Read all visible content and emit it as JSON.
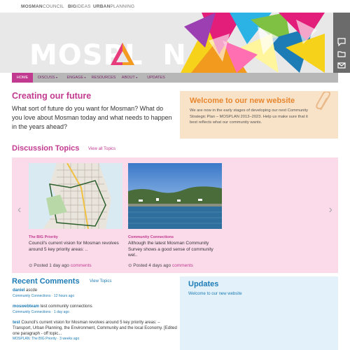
{
  "top_links": [
    {
      "bold": "MOSMAN",
      "rest": "COUNCIL"
    },
    {
      "bold": "BIG",
      "rest": "IDEAS"
    },
    {
      "bold": "URBAN",
      "rest": "PLANNING"
    }
  ],
  "logo": {
    "text": "MOSPL",
    "text_end": "N"
  },
  "side_icons": [
    "speech-bubble-icon",
    "folder-icon",
    "mail-icon"
  ],
  "nav": [
    {
      "label": "HOME",
      "active": true
    },
    {
      "label": "DISCUSS",
      "caret": true
    },
    {
      "label": "ENGAGE",
      "caret": true
    },
    {
      "label": "RESOURCES"
    },
    {
      "label": "ABOUT",
      "caret": true
    },
    {
      "label": "UPDATES"
    }
  ],
  "intro": {
    "title": "Creating our future",
    "body": "What sort of future do you want for Mosman? What do you love about Mosman today and what needs to happen in the years ahead?"
  },
  "welcome": {
    "title": "Welcome to our new website",
    "body": "We are now in the early stages of developing our next Community Strategic Plan – MOSPLAN 2013–2023. Help us make sure that it best reflects what our community wants."
  },
  "discussion": {
    "title": "Discussion Topics",
    "view_all": "View all Topics",
    "cards": [
      {
        "category": "The BIG Priority",
        "excerpt": "Council's current vision for Mosman revolves around 5 key priority areas: ..",
        "posted": "Posted 1 day ago",
        "comments": "comments"
      },
      {
        "category": "Community Connections",
        "excerpt": "Although the latest Mosman Community Survey shows a good sense of community wel..",
        "posted": "Posted 4 days ago",
        "comments": "comments"
      }
    ]
  },
  "recent_comments": {
    "title": "Recent Comments",
    "view_topics": "View Topics",
    "items": [
      {
        "author": "daniel",
        "text": "ascde",
        "meta": "Community Connections · 12 hours ago"
      },
      {
        "author": "moswebteam",
        "text": "test community connections",
        "meta": "Community Connections · 1 day ago"
      },
      {
        "author": "test",
        "text": "Council's current vision for Mosman revolves around 5 key priority areas: – Transport, Urban Planning, the Environment, Community and the local Economy. [Edited one paragraph - off topic...",
        "meta": "MOSPLAN: The BIG Priority · 3 weeks ago"
      }
    ]
  },
  "updates": {
    "title": "Updates",
    "link": "Welcome to our new website"
  },
  "colors": {
    "accent_magenta": "#c23a8f",
    "accent_blue": "#1d7bb5",
    "accent_orange": "#e8862e",
    "panel_pink": "#fbdbea",
    "panel_peach": "#f9e3c8",
    "panel_blue": "#e3f2fa"
  }
}
